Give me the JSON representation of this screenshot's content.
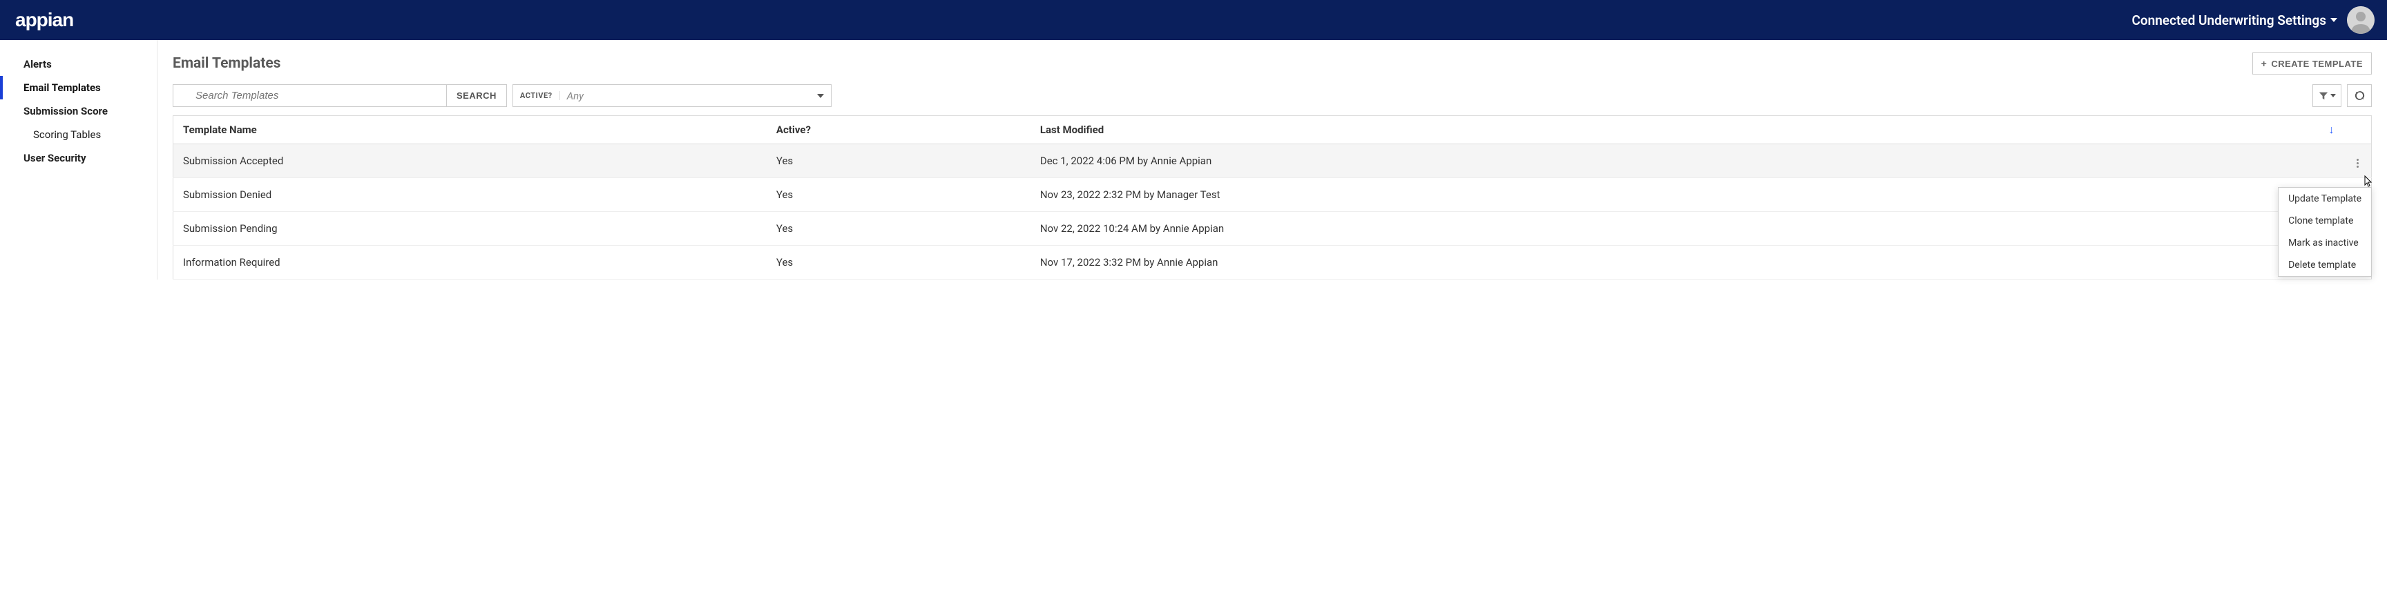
{
  "header": {
    "logo_text": "appian",
    "settings_label": "Connected Underwriting Settings"
  },
  "sidebar": {
    "items": [
      {
        "label": "Alerts",
        "slug": "alerts",
        "active": false,
        "child": false
      },
      {
        "label": "Email Templates",
        "slug": "email-templates",
        "active": true,
        "child": false
      },
      {
        "label": "Submission Score",
        "slug": "submission-score",
        "active": false,
        "child": false
      },
      {
        "label": "Scoring Tables",
        "slug": "scoring-tables",
        "active": false,
        "child": true
      },
      {
        "label": "User Security",
        "slug": "user-security",
        "active": false,
        "child": false
      }
    ]
  },
  "page": {
    "title": "Email Templates",
    "create_button": "CREATE TEMPLATE"
  },
  "filters": {
    "search_placeholder": "Search Templates",
    "search_button": "SEARCH",
    "active_label": "ACTIVE?",
    "active_value": "Any"
  },
  "table": {
    "columns": {
      "name": "Template Name",
      "active": "Active?",
      "modified": "Last Modified"
    },
    "rows": [
      {
        "name": "Submission Accepted",
        "active": "Yes",
        "modified": "Dec 1, 2022 4:06 PM by Annie Appian",
        "hovered": true
      },
      {
        "name": "Submission Denied",
        "active": "Yes",
        "modified": "Nov 23, 2022 2:32 PM by Manager Test",
        "hovered": false
      },
      {
        "name": "Submission Pending",
        "active": "Yes",
        "modified": "Nov 22, 2022 10:24 AM by Annie Appian",
        "hovered": false
      },
      {
        "name": "Information Required",
        "active": "Yes",
        "modified": "Nov 17, 2022 3:32 PM by Annie Appian",
        "hovered": false
      }
    ]
  },
  "context_menu": {
    "items": [
      "Update Template",
      "Clone template",
      "Mark as inactive",
      "Delete template"
    ]
  }
}
